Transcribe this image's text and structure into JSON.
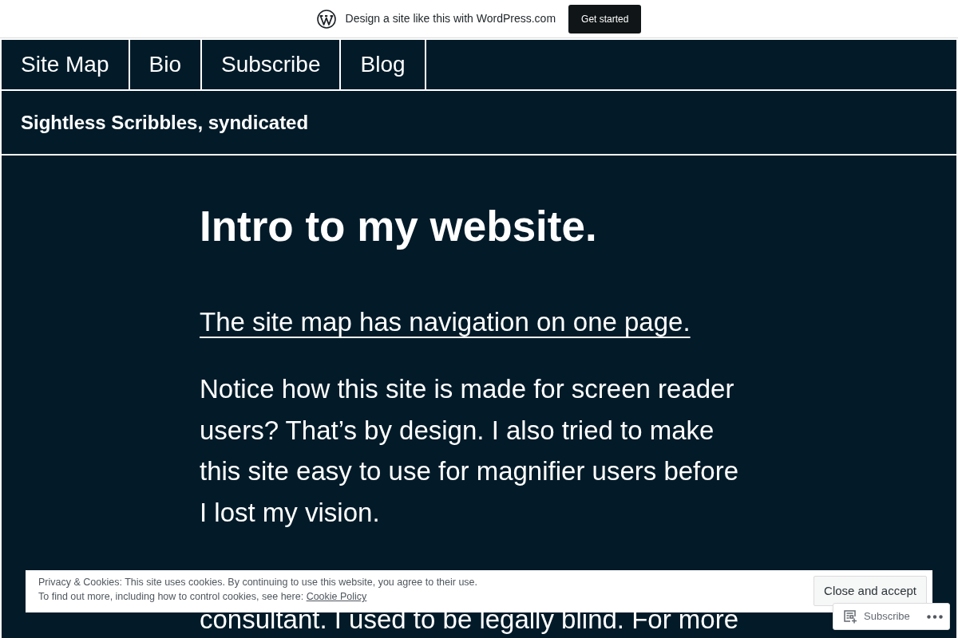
{
  "wpcom_bar": {
    "message": "Design a site like this with WordPress.com",
    "button": "Get started"
  },
  "nav": [
    "Site Map",
    "Bio",
    "Subscribe",
    "Blog"
  ],
  "site_title": "Sightless Scribbles, syndicated",
  "post": {
    "title": "Intro to my website.",
    "link": "The site map has navigation on one page.",
    "paragraph": "Notice how this site is made for screen reader users? That’s by design. I also tried to make this site easy to use for magnifier users before I lost my vision.",
    "paragraph_continued": "consultant. I used to be legally blind. For more"
  },
  "cookie_banner": {
    "lines": [
      "Privacy & Cookies: This site uses cookies. By continuing to use this website, you agree to their use.",
      "To find out more, including how to control cookies, see here:"
    ],
    "link": "Cookie Policy",
    "button": "Close and accept"
  },
  "subscribe_widget": {
    "label": "Subscribe"
  }
}
